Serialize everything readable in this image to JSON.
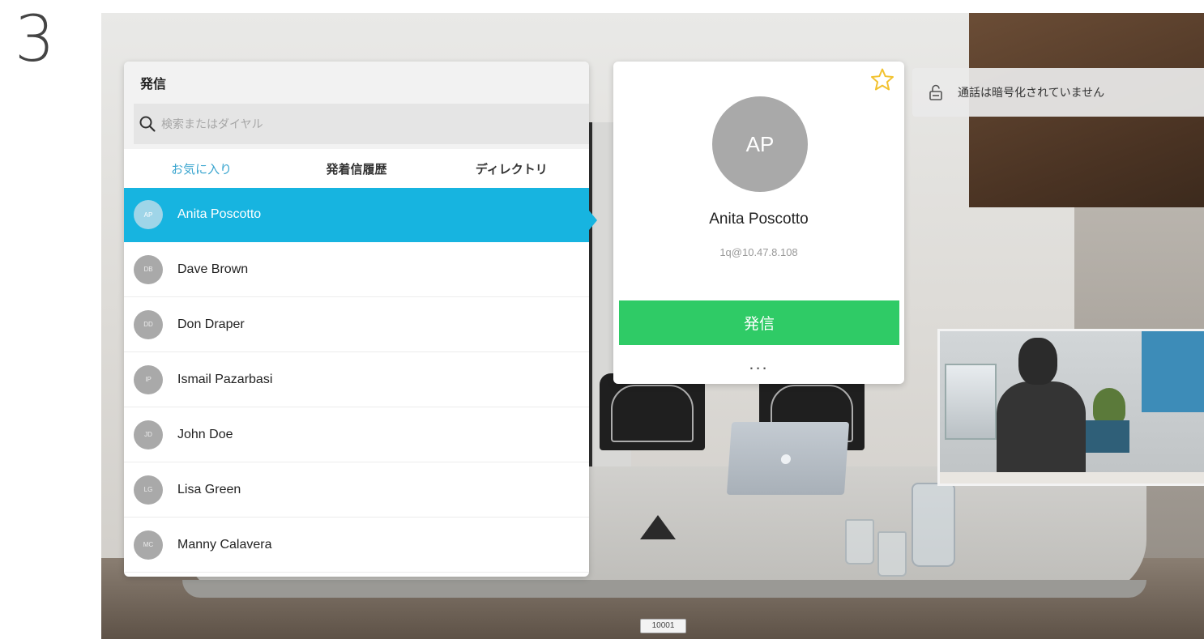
{
  "step_number": "3",
  "dial_panel": {
    "title": "発信",
    "search": {
      "placeholder": "検索またはダイヤル",
      "value": ""
    },
    "tabs": [
      {
        "label": "お気に入り",
        "active": true
      },
      {
        "label": "発着信履歴",
        "active": false
      },
      {
        "label": "ディレクトリ",
        "active": false
      }
    ],
    "contacts": [
      {
        "initials": "AP",
        "name": "Anita Poscotto",
        "selected": true
      },
      {
        "initials": "DB",
        "name": "Dave Brown",
        "selected": false
      },
      {
        "initials": "DD",
        "name": "Don Draper",
        "selected": false
      },
      {
        "initials": "IP",
        "name": "Ismail Pazarbasi",
        "selected": false
      },
      {
        "initials": "JD",
        "name": "John Doe",
        "selected": false
      },
      {
        "initials": "LG",
        "name": "Lisa Green",
        "selected": false
      },
      {
        "initials": "MC",
        "name": "Manny Calavera",
        "selected": false
      }
    ]
  },
  "contact_detail": {
    "initials": "AP",
    "name": "Anita Poscotto",
    "uri": "1q@10.47.8.108",
    "call_label": "発信",
    "more_label": "...",
    "favorite_icon": "star-outline-icon"
  },
  "encryption_notice": {
    "icon": "lock-open-icon",
    "text": "通話は暗号化されていません"
  },
  "scene": {
    "table_tag": "10001"
  },
  "colors": {
    "accent": "#17b4e0",
    "tab_active": "#3aa5cf",
    "call_button": "#2fcb66",
    "avatar": "#a9a9a9",
    "star": "#f2c230"
  }
}
